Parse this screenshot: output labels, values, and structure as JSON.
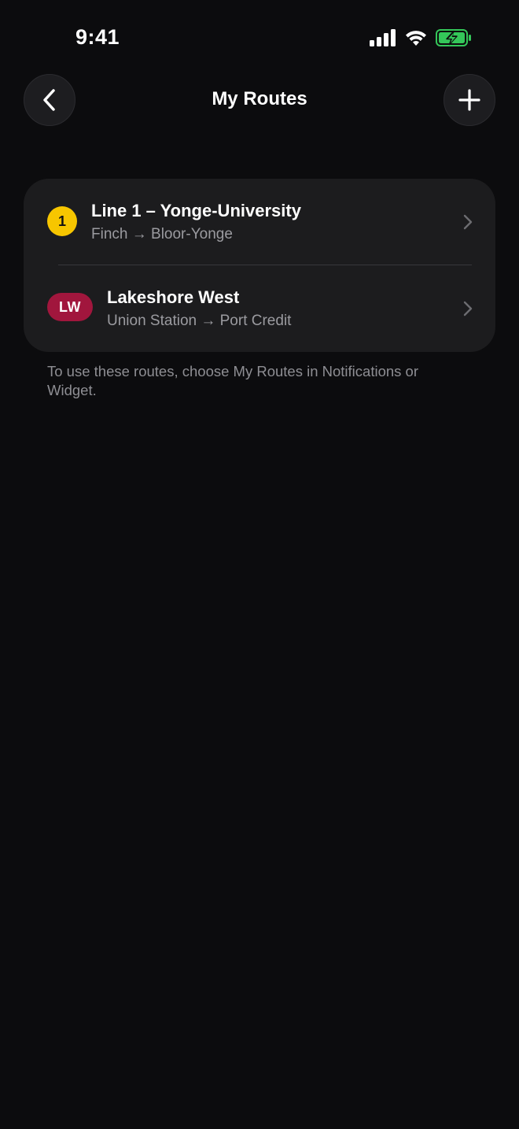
{
  "status_bar": {
    "time": "9:41",
    "icons": [
      "signal-icon",
      "wifi-icon",
      "battery-charging-icon"
    ],
    "battery_color": "#34c759"
  },
  "header": {
    "title": "My Routes",
    "back_icon": "chevron-left-icon",
    "add_icon": "plus-icon"
  },
  "routes": [
    {
      "badge": "1",
      "badge_color": "#f7c600",
      "title": "Line 1 – Yonge-University",
      "subtitle": "Finch → Bloor-Yonge",
      "chevron_icon": "chevron-right-icon"
    },
    {
      "badge": "LW",
      "badge_color": "#a1163d",
      "title": "Lakeshore West",
      "subtitle": "Union Station → Port Credit",
      "chevron_icon": "chevron-right-icon"
    }
  ],
  "footnote": "To use these routes, choose My Routes in Notifications or Widget."
}
